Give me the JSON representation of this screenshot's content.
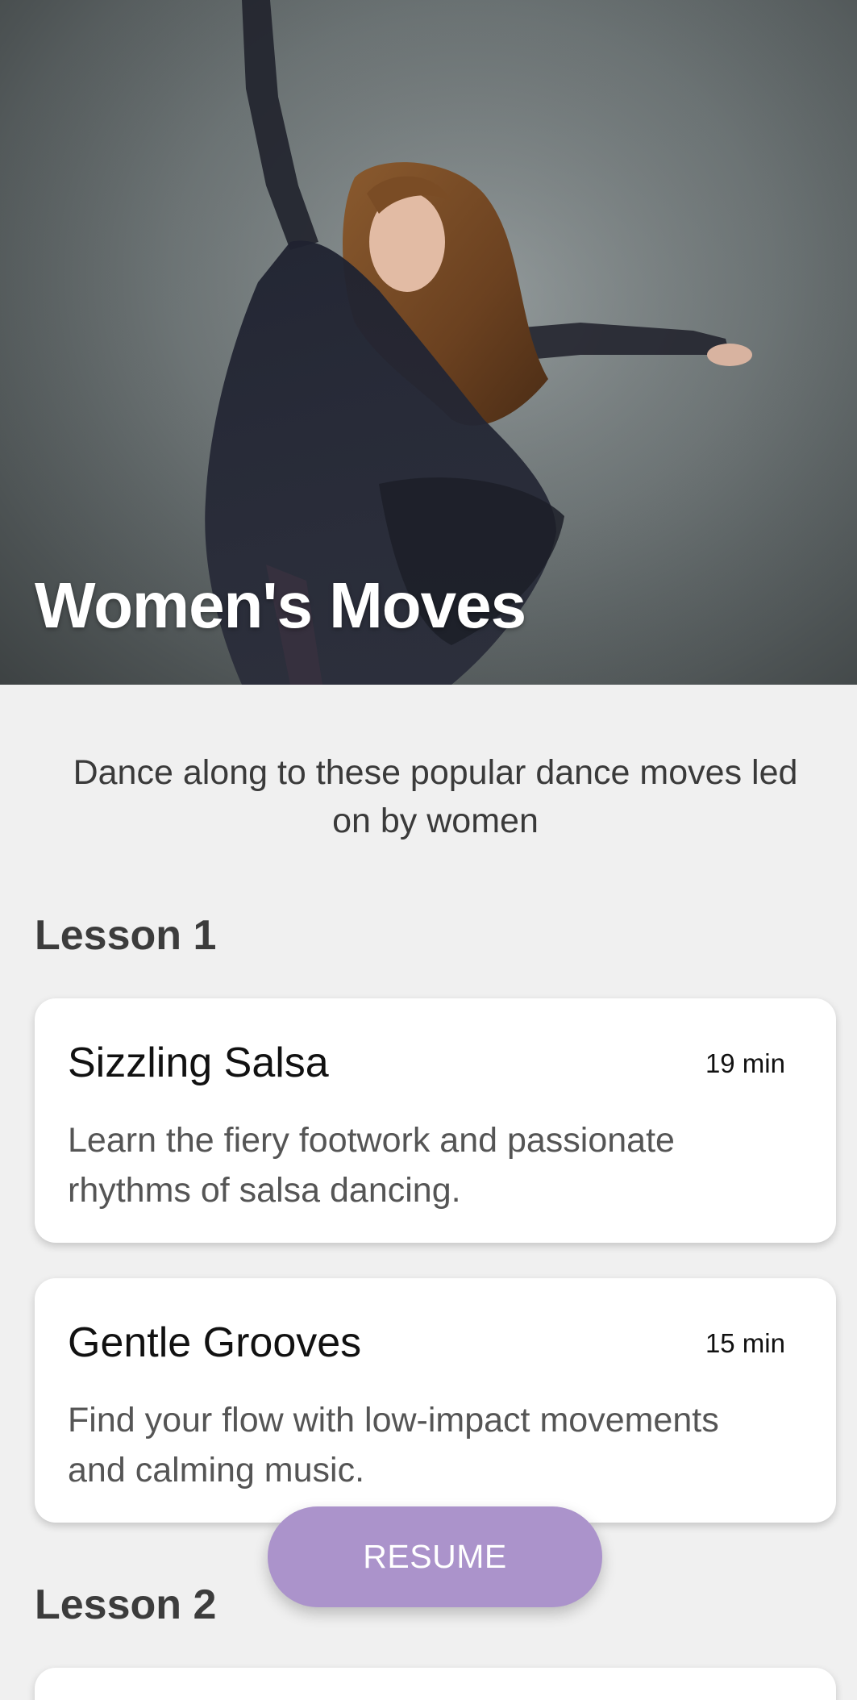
{
  "hero": {
    "title": "Women's Moves",
    "image_description": "dancer-photo"
  },
  "intro": {
    "text": "Dance along to these popular dance moves led on by women"
  },
  "lessons": [
    {
      "heading": "Lesson 1",
      "cards": [
        {
          "title": "Sizzling Salsa",
          "duration": "19 min",
          "description": "Learn the fiery footwork and passionate rhythms of salsa dancing."
        },
        {
          "title": "Gentle Grooves",
          "duration": "15 min",
          "description": "Find your flow with low-impact movements and calming music."
        }
      ]
    },
    {
      "heading": "Lesson 2",
      "cards": []
    }
  ],
  "resume_button": {
    "label": "RESUME",
    "color": "#ab93cb"
  },
  "colors": {
    "background": "#f0f0f0",
    "card": "#ffffff",
    "accent": "#ab93cb"
  }
}
